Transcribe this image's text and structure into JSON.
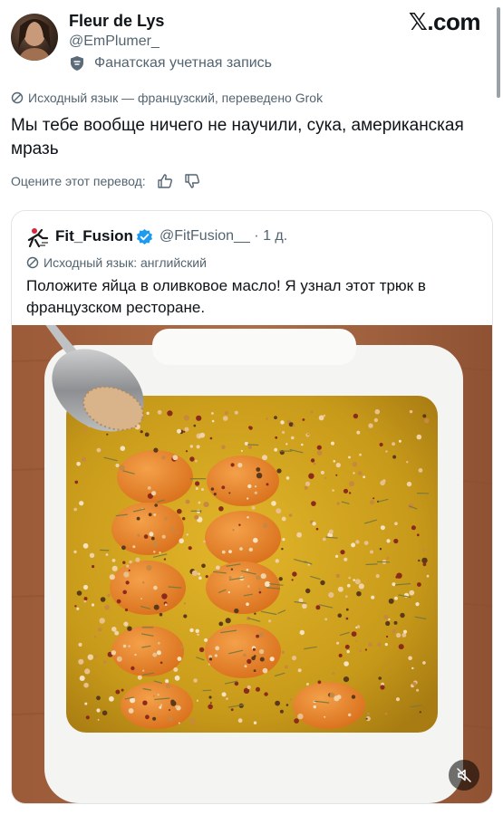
{
  "author": {
    "display_name": "Fleur de Lys",
    "handle": "@EmPlumer_",
    "account_label": "Фанатская учетная запись"
  },
  "brand": {
    "logo_text": ".com"
  },
  "translation": {
    "note": "Исходный язык — французский, переведено Grok",
    "text": "Мы тебе вообще ничего не научили, сука, американская мразь",
    "rate_prompt": "Оцените этот перевод:"
  },
  "quoted": {
    "display_name": "Fit_Fusion",
    "handle": "@FitFusion__",
    "time": "· 1 д.",
    "original_language": "Исходный язык: английский",
    "text": "Положите яйца в оливковое масло! Я узнал этот трюк в французском ресторане."
  },
  "icons": {
    "account_badge": "fan-shield-icon",
    "translate": "translate-icon",
    "like": "thumbs-up-icon",
    "dislike": "thumbs-down-icon",
    "verified": "verified-badge-icon",
    "mute": "muted-speaker-icon"
  },
  "colors": {
    "verified": "#1d9bf0",
    "secondary_text": "#536471"
  }
}
